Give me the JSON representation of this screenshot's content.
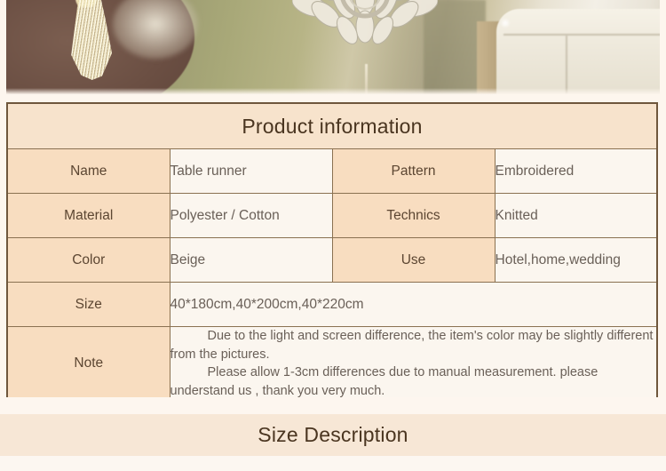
{
  "hero": {
    "alt": "Beige embroidered table runner with tassel draped over a round wooden table"
  },
  "product_info": {
    "title": "Product information",
    "rows": [
      {
        "left_label": "Name",
        "left_value": "Table runner",
        "right_label": "Pattern",
        "right_value": "Embroidered"
      },
      {
        "left_label": "Material",
        "left_value": "Polyester / Cotton",
        "right_label": "Technics",
        "right_value": "Knitted"
      },
      {
        "left_label": "Color",
        "left_value": "Beige",
        "right_label": "Use",
        "right_value": "Hotel,home,wedding"
      }
    ],
    "size_row": {
      "label": "Size",
      "value": "40*180cm,40*200cm,40*220cm"
    },
    "note_row": {
      "label": "Note",
      "paragraphs": [
        "Due to the light and screen difference, the item's color may be slightly different from the pictures.",
        "Please allow 1-3cm differences due to manual measurement. please understand us , thank you very much."
      ]
    }
  },
  "size_description": {
    "title": "Size Description"
  },
  "colors": {
    "page_background": "#fdf6ee",
    "table_border": "#6f573c",
    "cell_border": "#8a7151",
    "header_background": "#f7e3cc",
    "label_background": "#f8ddc0",
    "value_background": "#fbf6ef",
    "title_text": "#4a3520",
    "label_text": "#5c4632",
    "value_text": "#6a6058",
    "size_band_background": "#f7e7d6"
  }
}
